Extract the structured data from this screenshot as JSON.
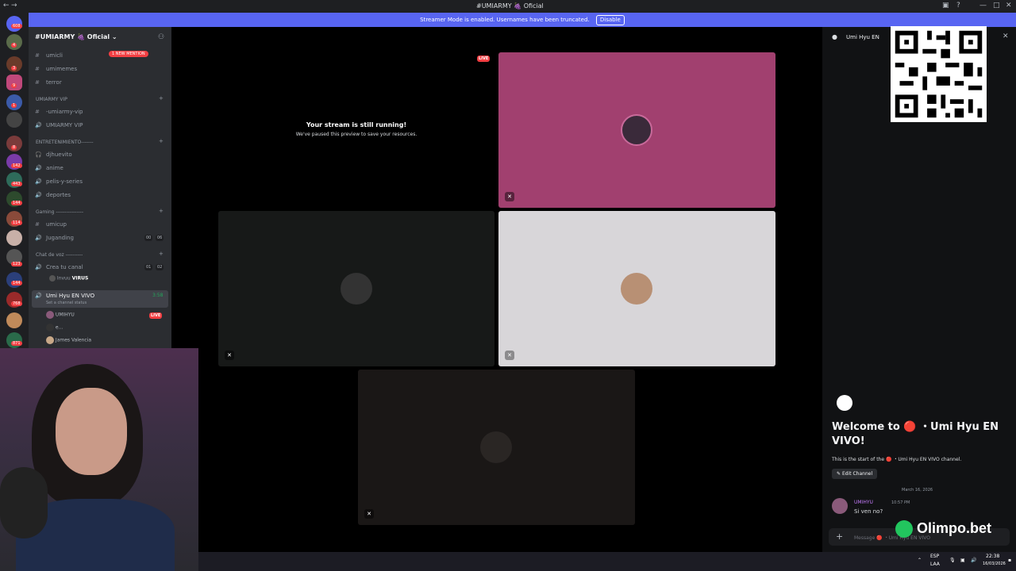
{
  "window": {
    "title": "#UMIARMY 🍇 Oficial"
  },
  "banner": {
    "text": "Streamer Mode is enabled. Usernames have been truncated.",
    "disable_label": "Disable"
  },
  "rail": {
    "badges": [
      "608",
      "4",
      "3",
      "9",
      "1",
      "8",
      "142",
      "443",
      "144",
      "114",
      "6",
      "123",
      "144",
      "768",
      "871"
    ]
  },
  "sidebar": {
    "server_name": "#UMIARMY 🍇 Oficial ⌄",
    "mention_label": "1 NEW MENTION",
    "channels_top": [
      {
        "icon": "#",
        "name": "umicli"
      },
      {
        "icon": "#",
        "name": "umimemes"
      },
      {
        "icon": "#",
        "name": "terror"
      }
    ],
    "cat_vip": "UMIARMY VIP",
    "vip_channels": [
      {
        "icon": "#",
        "name": "-umiarmy-vip"
      },
      {
        "icon": "🔊",
        "name": "UMIARMY VIP"
      }
    ],
    "cat_ent": "ENTRETENIMIENTO-------",
    "ent_channels": [
      {
        "icon": "🎧",
        "name": "djhuevito"
      },
      {
        "icon": "🔊",
        "name": "anime"
      },
      {
        "icon": "🔊",
        "name": "pelis-y-series"
      },
      {
        "icon": "🔊",
        "name": "deportes"
      }
    ],
    "cat_gaming": "Gaming ----------------",
    "gaming_channels": [
      {
        "icon": "#",
        "name": "umicup"
      },
      {
        "icon": "🔊",
        "name": "Juganding",
        "count_a": "00",
        "count_b": "06"
      }
    ],
    "cat_voice": "Chat de voz ----------",
    "voice_channels": [
      {
        "icon": "🔊",
        "name": "Crea tu canal",
        "count_a": "01",
        "count_b": "02"
      }
    ],
    "voice_user_1": "Invuu",
    "voice_user_1_tag": "VIRUS",
    "active_channel": {
      "name": "Umi Hyu EN VIVO",
      "timer": "3:58",
      "status": "Set a channel status"
    },
    "members": [
      {
        "name": "UMIHYU",
        "live": "LIVE"
      },
      {
        "name": "e..."
      },
      {
        "name": "James Valencia"
      }
    ]
  },
  "stage": {
    "live_badge": "LIVE",
    "paused_title": "Your stream is still running!",
    "paused_sub": "We've paused this preview to save your resources."
  },
  "chat": {
    "channel_title": "Umi Hyu EN",
    "welcome": "Welcome to 🔴 ・Umi Hyu EN VIVO!",
    "start_text": "This is the start of the 🔴 ・Umi Hyu EN VIVO channel.",
    "edit_label": "Edit Channel",
    "date": "March 16, 2026",
    "message": {
      "author": "UMIHYU",
      "time": "10:57 PM",
      "text": "Si ven no?"
    },
    "input_placeholder": "Message 🔴 ・Umi Hyu EN VIVO"
  },
  "overlay": {
    "sponsor": "Olimpo.bet"
  },
  "taskbar": {
    "lang_top": "ESP",
    "lang_bottom": "LAA",
    "time": "22:38",
    "date": "16/03/2026"
  },
  "colors": {
    "accent": "#5865f2",
    "live": "#f23f43",
    "tile_pink": "#a1406f",
    "tile_light": "#d8d6d9"
  }
}
